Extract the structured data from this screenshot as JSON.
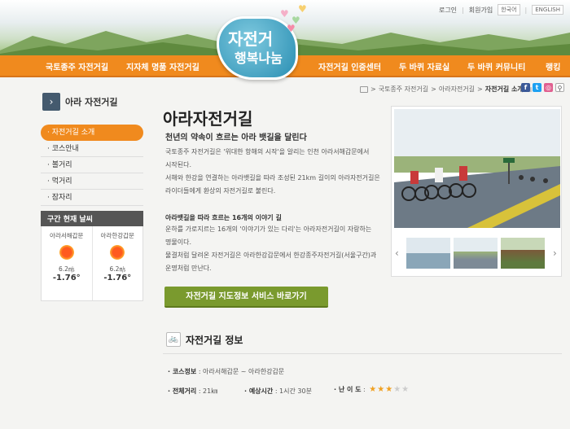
{
  "util": {
    "login": "로그인",
    "join": "회원가입",
    "lang_ko": "한국어",
    "lang_en": "ENGLISH"
  },
  "logo": {
    "line1": "자전거",
    "line2": "행복나눔"
  },
  "nav": {
    "items": [
      "국토종주 자전거길",
      "지자체 명품 자전거길",
      "자전거길 인증센터",
      "두 바퀴 자료실",
      "두 바퀴 커뮤니티",
      "랭킹"
    ]
  },
  "breadcrumb": {
    "home": "홈",
    "level1": "국토종주 자전거길",
    "level2": "아라자전거길",
    "current": "자전거길 소개"
  },
  "sidebar": {
    "title": "아라 자전거길",
    "items": [
      {
        "label": "· 자전거길 소개",
        "active": true
      },
      {
        "label": "· 코스안내",
        "active": false
      },
      {
        "label": "· 볼거리",
        "active": false
      },
      {
        "label": "· 먹거리",
        "active": false
      },
      {
        "label": "· 잠자리",
        "active": false
      }
    ]
  },
  "weather": {
    "title": "구간 현재 날씨",
    "stations": [
      {
        "name": "아라서해갑문",
        "wind": "6.2㎧",
        "temp": "-1.76°"
      },
      {
        "name": "아라한강갑문",
        "wind": "6.2㎧",
        "temp": "-1.76°"
      }
    ]
  },
  "main": {
    "title": "아라자전거길",
    "subtitle": "천년의 약속이 흐르는 아라 뱃길을 달린다",
    "p1": [
      "국토종주 자전거길은 '위대한 항해의 시작'을 알리는 인천 아라서해갑문에서",
      "시작된다.",
      "서해와 한강을 연결하는 아라뱃길을 따라 조성된 21km 길이의  아라자전거길은",
      "라이더들에게 환상의 자전거길로 불린다."
    ],
    "p2_head": "아라뱃길을 따라 흐르는 16개의 이야기 길",
    "p2": [
      "운하를 가로지르는 16개의 '이야기가 있는 다리'는 아라자전거길이 자랑하는",
      "명물이다.",
      "물결처럼 달려온 자전거길은 아라한강갑문에서 한강종주자전거길(서울구간)과",
      "운명처럼 만난다."
    ],
    "cta": "자전거길 지도정보 서비스 바로가기"
  },
  "info": {
    "title": "자전거길 정보",
    "course_label": "· 코스정보",
    "course_value": ": 아라서해갑문 ~ 아라한강갑문",
    "distance_label": "· 전체거리",
    "distance_value": ": 21㎞",
    "time_label": "· 예상시간",
    "time_value": ": 1시간 30분",
    "difficulty_label": "· 난 이 도",
    "difficulty_value": ":",
    "difficulty_stars": 3,
    "difficulty_max": 5
  },
  "colors": {
    "nav": "#f08a1e",
    "cta": "#7a9a2e",
    "accent": "#f08a1e"
  }
}
